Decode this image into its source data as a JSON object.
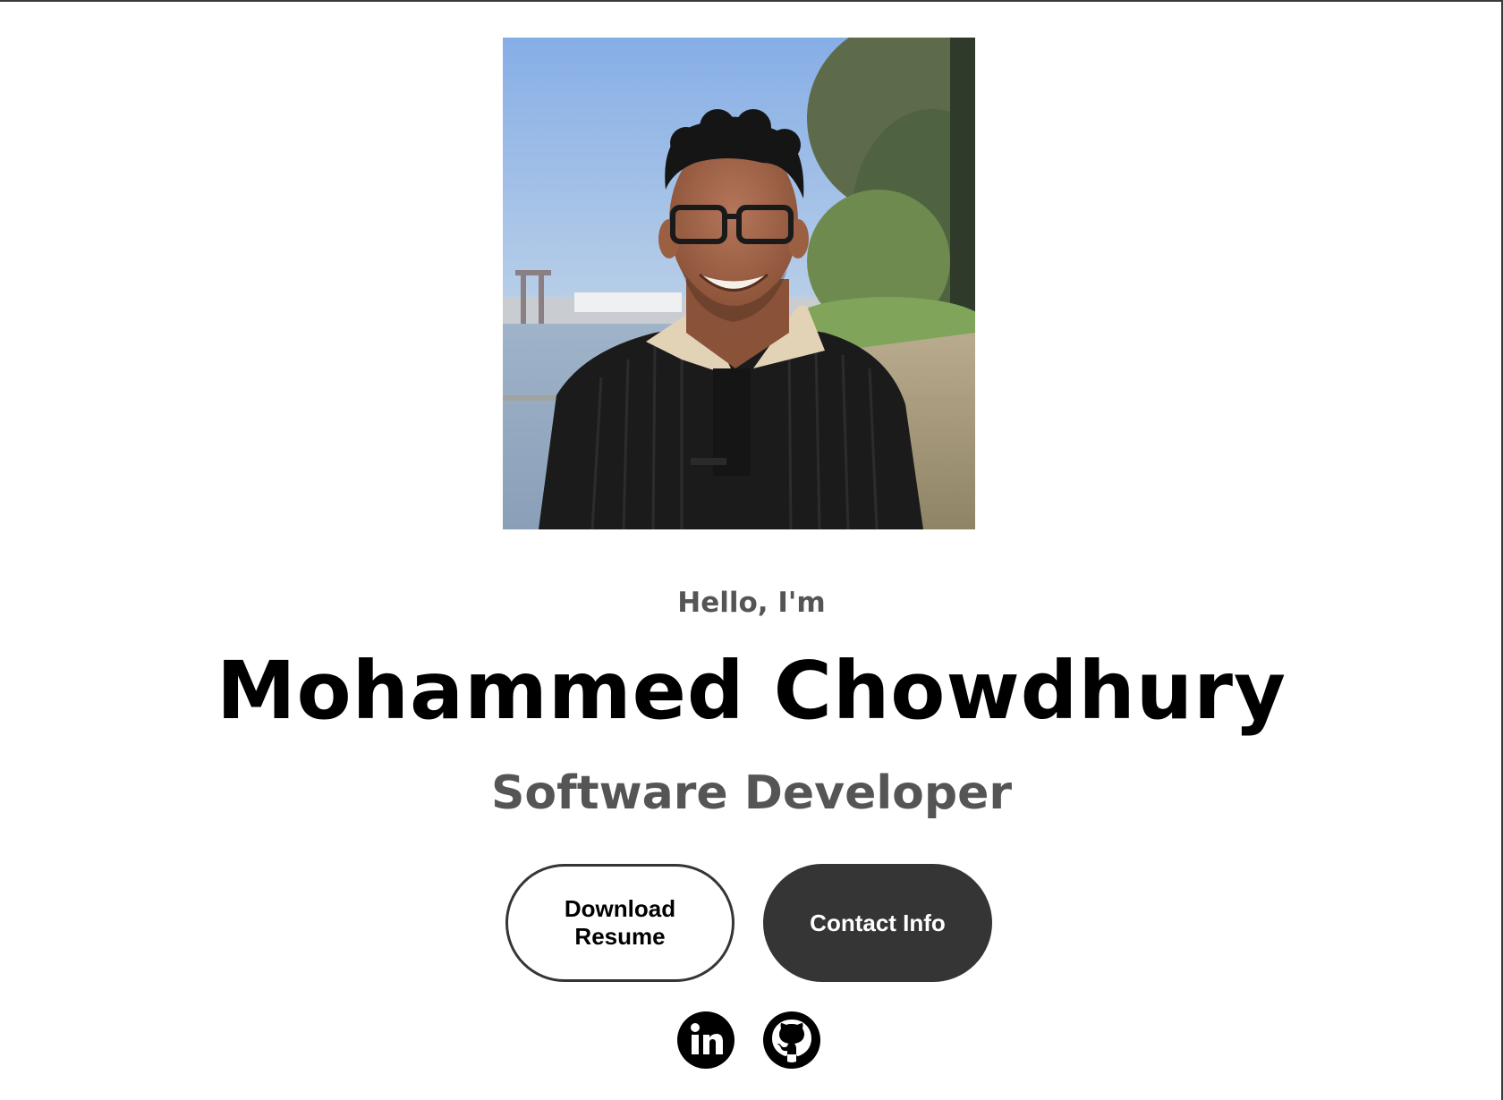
{
  "hero": {
    "greeting": "Hello, I'm",
    "name": "Mohammed Chowdhury",
    "title": "Software Developer",
    "photo_alt": "Profile picture of Mohammed Chowdhury"
  },
  "buttons": {
    "resume_label": "Download Resume",
    "contact_label": "Contact Info"
  },
  "social": {
    "linkedin_icon": "linkedin-icon",
    "github_icon": "github-icon"
  },
  "colors": {
    "text_primary": "#000000",
    "text_secondary": "#555555",
    "button_dark": "#353535",
    "background": "#ffffff"
  }
}
